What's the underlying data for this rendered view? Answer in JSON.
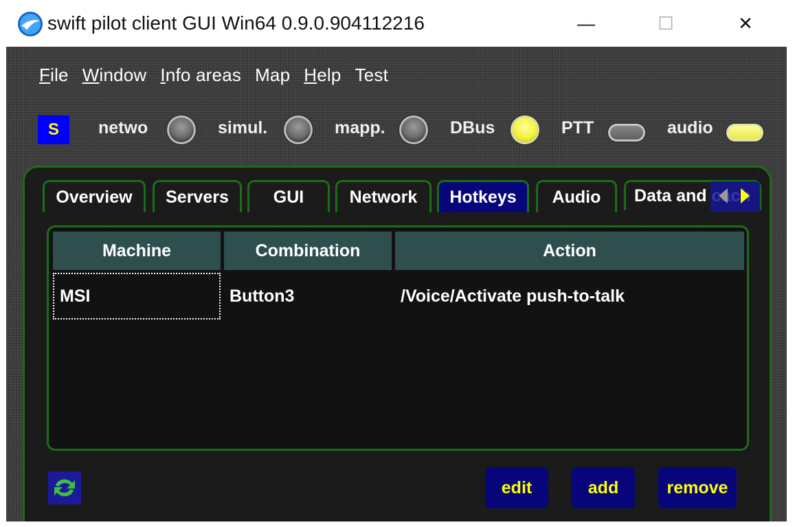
{
  "window": {
    "title": "swift pilot client GUI Win64 0.9.0.904112216",
    "minimize_glyph": "—",
    "maximize_glyph": "☐",
    "close_glyph": "✕"
  },
  "menu": [
    {
      "label": "File",
      "mnemonic": "F"
    },
    {
      "label": "Window",
      "mnemonic": "W"
    },
    {
      "label": "Info areas",
      "mnemonic": "I"
    },
    {
      "label": "Map",
      "mnemonic": ""
    },
    {
      "label": "Help",
      "mnemonic": "H"
    },
    {
      "label": "Test",
      "mnemonic": ""
    }
  ],
  "status": {
    "badge": "S",
    "indicators": [
      {
        "label": "netwo",
        "state": "off",
        "shape": "round"
      },
      {
        "label": "simul.",
        "state": "off",
        "shape": "round"
      },
      {
        "label": "mapp.",
        "state": "off",
        "shape": "round"
      },
      {
        "label": "DBus",
        "state": "on",
        "shape": "round"
      },
      {
        "label": "PTT",
        "state": "off",
        "shape": "pill"
      },
      {
        "label": "audio",
        "state": "on",
        "shape": "pill"
      }
    ]
  },
  "tabs": [
    {
      "label": "Overview",
      "active": false
    },
    {
      "label": "Servers",
      "active": false
    },
    {
      "label": "GUI",
      "active": false
    },
    {
      "label": "Network",
      "active": false
    },
    {
      "label": "Hotkeys",
      "active": true
    },
    {
      "label": "Audio",
      "active": false
    },
    {
      "label": "Data and cach",
      "active": false
    }
  ],
  "hotkeys_table": {
    "columns": [
      "Machine",
      "Combination",
      "Action"
    ],
    "rows": [
      [
        "MSI",
        "Button3",
        "/Voice/Activate push-to-talk"
      ]
    ]
  },
  "buttons": {
    "edit": "edit",
    "add": "add",
    "remove": "remove"
  },
  "colors": {
    "accent_green": "#1a6e1a",
    "active_tab": "#06067a",
    "button_text": "#ffff00",
    "header_bg": "#2f4f4f"
  }
}
